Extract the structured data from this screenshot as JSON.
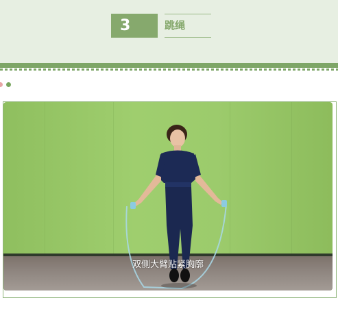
{
  "section": {
    "number": "3",
    "title": "跳绳"
  },
  "video": {
    "caption": "双侧大臂贴紧胸廓"
  },
  "colors": {
    "header_bg": "#e7efe2",
    "accent": "#7ea667",
    "badge": "#86a96d",
    "dot_pink": "#e7a6a6",
    "dot_green": "#78a55f"
  }
}
